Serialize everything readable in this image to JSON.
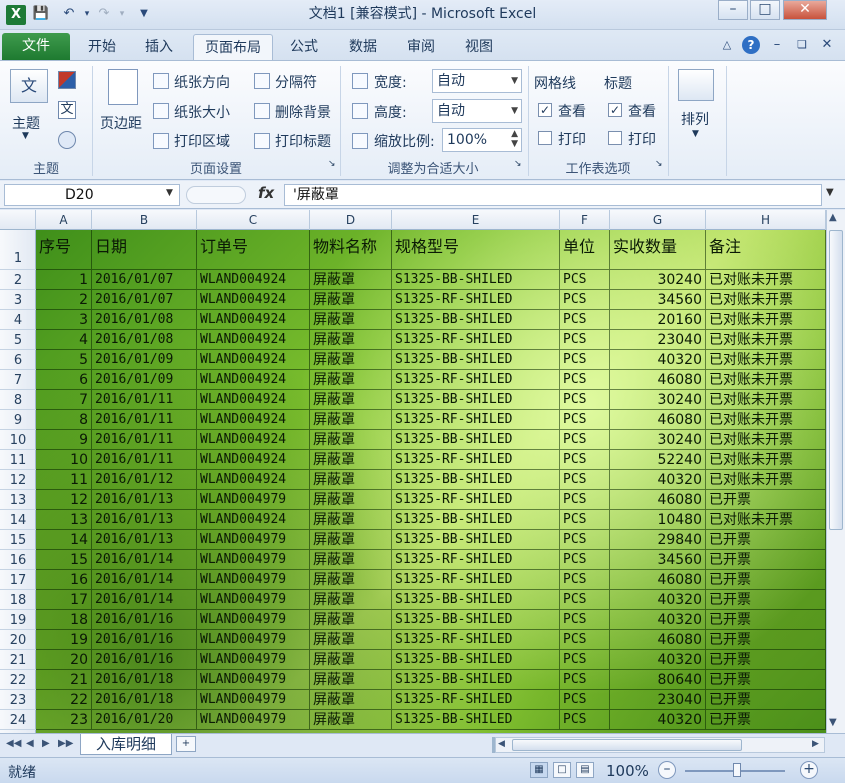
{
  "window": {
    "title": "文档1 [兼容模式] - Microsoft Excel",
    "app_icon": "X",
    "qa_icons": [
      "save-icon",
      "undo-icon",
      "redo-icon",
      "customize-icon"
    ]
  },
  "tabs": [
    "文件",
    "开始",
    "插入",
    "页面布局",
    "公式",
    "数据",
    "审阅",
    "视图"
  ],
  "ribbon": {
    "themes": {
      "label": "主题",
      "group": "主题"
    },
    "page_setup": {
      "margins": "页边距",
      "orientation": "纸张方向",
      "size": "纸张大小",
      "print_area": "打印区域",
      "breaks": "分隔符",
      "background": "删除背景",
      "print_titles": "打印标题",
      "group": "页面设置"
    },
    "scale": {
      "width_label": "宽度:",
      "width_value": "自动",
      "height_label": "高度:",
      "height_value": "自动",
      "scale_label": "缩放比例:",
      "scale_value": "100%",
      "group": "调整为合适大小"
    },
    "sheet_options": {
      "gridlines": "网格线",
      "headings": "标题",
      "view": "查看",
      "print": "打印",
      "group": "工作表选项"
    },
    "arrange": {
      "label": "排列"
    }
  },
  "formula_bar": {
    "name_box": "D20",
    "fx": "fx",
    "content": "'屏蔽罩"
  },
  "columns": [
    "A",
    "B",
    "C",
    "D",
    "E",
    "F",
    "G",
    "H"
  ],
  "rows": [
    "1",
    "2",
    "3",
    "4",
    "5",
    "6",
    "7",
    "8",
    "9",
    "10",
    "11",
    "12",
    "13",
    "14",
    "15",
    "16",
    "17",
    "18",
    "19",
    "20",
    "21",
    "22",
    "23",
    "24"
  ],
  "table": {
    "headers": [
      "序号",
      "日期",
      "订单号",
      "物料名称",
      "规格型号",
      "单位",
      "实收数量",
      "备注"
    ],
    "data": [
      [
        "1",
        "2016/01/07",
        "WLAND004924",
        "屏蔽罩",
        "S1325-BB-SHILED",
        "PCS",
        "30240",
        "已对账未开票"
      ],
      [
        "2",
        "2016/01/07",
        "WLAND004924",
        "屏蔽罩",
        "S1325-RF-SHILED",
        "PCS",
        "34560",
        "已对账未开票"
      ],
      [
        "3",
        "2016/01/08",
        "WLAND004924",
        "屏蔽罩",
        "S1325-BB-SHILED",
        "PCS",
        "20160",
        "已对账未开票"
      ],
      [
        "4",
        "2016/01/08",
        "WLAND004924",
        "屏蔽罩",
        "S1325-RF-SHILED",
        "PCS",
        "23040",
        "已对账未开票"
      ],
      [
        "5",
        "2016/01/09",
        "WLAND004924",
        "屏蔽罩",
        "S1325-BB-SHILED",
        "PCS",
        "40320",
        "已对账未开票"
      ],
      [
        "6",
        "2016/01/09",
        "WLAND004924",
        "屏蔽罩",
        "S1325-RF-SHILED",
        "PCS",
        "46080",
        "已对账未开票"
      ],
      [
        "7",
        "2016/01/11",
        "WLAND004924",
        "屏蔽罩",
        "S1325-BB-SHILED",
        "PCS",
        "30240",
        "已对账未开票"
      ],
      [
        "8",
        "2016/01/11",
        "WLAND004924",
        "屏蔽罩",
        "S1325-RF-SHILED",
        "PCS",
        "46080",
        "已对账未开票"
      ],
      [
        "9",
        "2016/01/11",
        "WLAND004924",
        "屏蔽罩",
        "S1325-BB-SHILED",
        "PCS",
        "30240",
        "已对账未开票"
      ],
      [
        "10",
        "2016/01/11",
        "WLAND004924",
        "屏蔽罩",
        "S1325-RF-SHILED",
        "PCS",
        "52240",
        "已对账未开票"
      ],
      [
        "11",
        "2016/01/12",
        "WLAND004924",
        "屏蔽罩",
        "S1325-BB-SHILED",
        "PCS",
        "40320",
        "已对账未开票"
      ],
      [
        "12",
        "2016/01/13",
        "WLAND004979",
        "屏蔽罩",
        "S1325-RF-SHILED",
        "PCS",
        "46080",
        "已开票"
      ],
      [
        "13",
        "2016/01/13",
        "WLAND004924",
        "屏蔽罩",
        "S1325-BB-SHILED",
        "PCS",
        "10480",
        "已对账未开票"
      ],
      [
        "14",
        "2016/01/13",
        "WLAND004979",
        "屏蔽罩",
        "S1325-BB-SHILED",
        "PCS",
        "29840",
        "已开票"
      ],
      [
        "15",
        "2016/01/14",
        "WLAND004979",
        "屏蔽罩",
        "S1325-RF-SHILED",
        "PCS",
        "34560",
        "已开票"
      ],
      [
        "16",
        "2016/01/14",
        "WLAND004979",
        "屏蔽罩",
        "S1325-RF-SHILED",
        "PCS",
        "46080",
        "已开票"
      ],
      [
        "17",
        "2016/01/14",
        "WLAND004979",
        "屏蔽罩",
        "S1325-BB-SHILED",
        "PCS",
        "40320",
        "已开票"
      ],
      [
        "18",
        "2016/01/16",
        "WLAND004979",
        "屏蔽罩",
        "S1325-BB-SHILED",
        "PCS",
        "40320",
        "已开票"
      ],
      [
        "19",
        "2016/01/16",
        "WLAND004979",
        "屏蔽罩",
        "S1325-RF-SHILED",
        "PCS",
        "46080",
        "已开票"
      ],
      [
        "20",
        "2016/01/16",
        "WLAND004979",
        "屏蔽罩",
        "S1325-BB-SHILED",
        "PCS",
        "40320",
        "已开票"
      ],
      [
        "21",
        "2016/01/18",
        "WLAND004979",
        "屏蔽罩",
        "S1325-BB-SHILED",
        "PCS",
        "80640",
        "已开票"
      ],
      [
        "22",
        "2016/01/18",
        "WLAND004979",
        "屏蔽罩",
        "S1325-RF-SHILED",
        "PCS",
        "23040",
        "已开票"
      ],
      [
        "23",
        "2016/01/20",
        "WLAND004979",
        "屏蔽罩",
        "S1325-BB-SHILED",
        "PCS",
        "40320",
        "已开票"
      ]
    ]
  },
  "sheet_tab": "入库明细",
  "status": {
    "ready": "就绪",
    "zoom": "100%"
  },
  "colors": {
    "file_tab": "#2a8a3c",
    "sheet_bg": "#7cbf2e"
  }
}
